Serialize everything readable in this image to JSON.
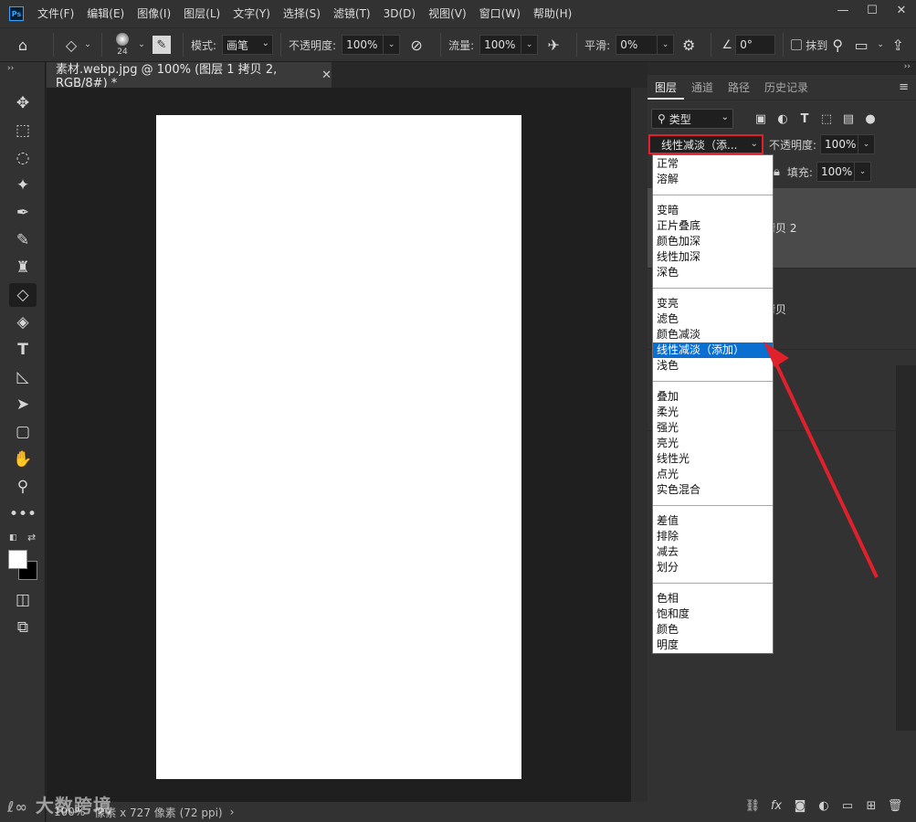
{
  "menubar": {
    "logo": "Ps",
    "items": [
      "文件(F)",
      "编辑(E)",
      "图像(I)",
      "图层(L)",
      "文字(Y)",
      "选择(S)",
      "滤镜(T)",
      "3D(D)",
      "视图(V)",
      "窗口(W)",
      "帮助(H)"
    ]
  },
  "options": {
    "brush_size": "24",
    "mode_label": "模式:",
    "mode_value": "画笔",
    "opacity_label": "不透明度:",
    "opacity_value": "100%",
    "flow_label": "流量:",
    "flow_value": "100%",
    "smooth_label": "平滑:",
    "smooth_value": "0%",
    "angle_value": "0°",
    "erase_history_label": "抹到"
  },
  "document": {
    "tab_title": "素材.webp.jpg @ 100% (图层 1 拷贝 2, RGB/8#) *",
    "status": "100%",
    "status_dims": "像素 x 727 像素 (72 ppi)",
    "watermark": "大数跨境"
  },
  "panel": {
    "tabs": [
      "图层",
      "通道",
      "路径",
      "历史记录"
    ],
    "filter_kind": "类型",
    "blend_mode_value": "线性减淡（添...",
    "opacity_label": "不透明度:",
    "opacity_value": "100%",
    "fill_label": "填充:",
    "fill_value": "100%",
    "layers": [
      {
        "name": "拷贝 2",
        "selected": true
      },
      {
        "name": "拷贝",
        "selected": false
      }
    ]
  },
  "blend_dropdown": {
    "groups": [
      [
        "正常",
        "溶解"
      ],
      [
        "变暗",
        "正片叠底",
        "颜色加深",
        "线性加深",
        "深色"
      ],
      [
        "变亮",
        "滤色",
        "颜色减淡",
        "线性减淡（添加）",
        "浅色"
      ],
      [
        "叠加",
        "柔光",
        "强光",
        "亮光",
        "线性光",
        "点光",
        "实色混合"
      ],
      [
        "差值",
        "排除",
        "减去",
        "划分"
      ],
      [
        "色相",
        "饱和度",
        "颜色",
        "明度"
      ]
    ],
    "selected": "线性减淡（添加）"
  },
  "colors": {
    "highlight": "#0a6fd0",
    "annotation_red": "#e0202a"
  }
}
